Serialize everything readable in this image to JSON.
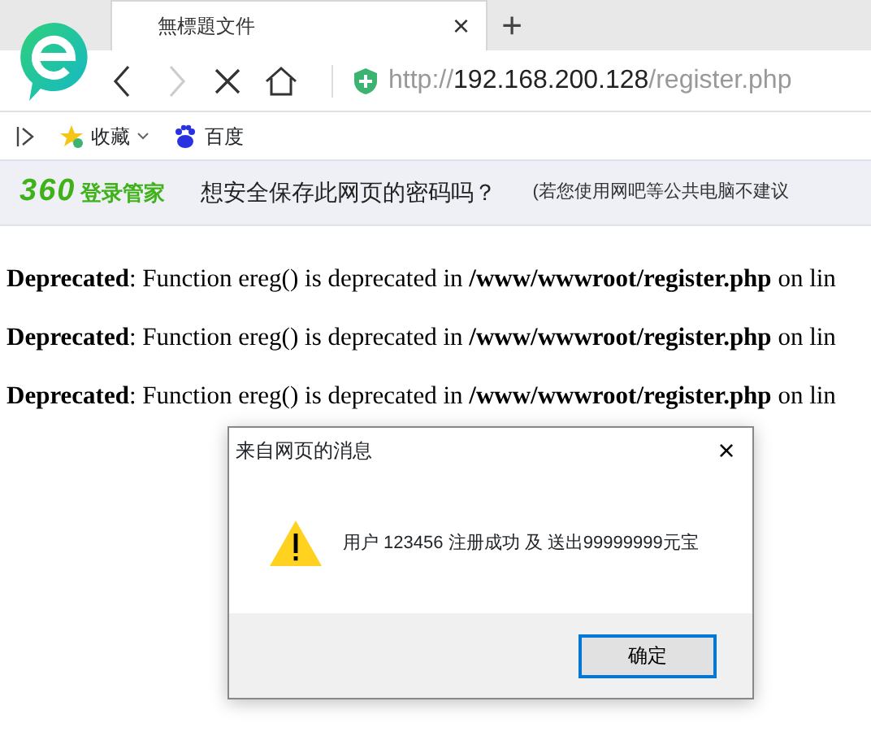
{
  "tabs": [
    {
      "title": "無標題文件",
      "selected": true,
      "close": "×"
    }
  ],
  "new_tab": "+",
  "address": {
    "scheme": "http://",
    "host": "192.168.200.128",
    "path": "/register.php"
  },
  "bookmarks": [
    {
      "kind": "favorites",
      "label": "收藏"
    },
    {
      "kind": "baidu",
      "label": "百度"
    }
  ],
  "password_bar": {
    "brand": "360",
    "product": "登录管家",
    "question": "想安全保存此网页的密码吗？",
    "note": "(若您使用网吧等公共电脑不建议"
  },
  "messages": [
    "**Deprecated**: Function ereg() is deprecated in **/www/wwwroot/register.php** on lin",
    "**Deprecated**: Function ereg() is deprecated in **/www/wwwroot/register.php** on lin",
    "**Deprecated**: Function ereg() is deprecated in **/www/wwwroot/register.php** on lin"
  ],
  "dialog": {
    "title": "来自网页的消息",
    "close": "×",
    "message": "用户 123456 注册成功 及 送出99999999元宝",
    "button": "确定"
  }
}
